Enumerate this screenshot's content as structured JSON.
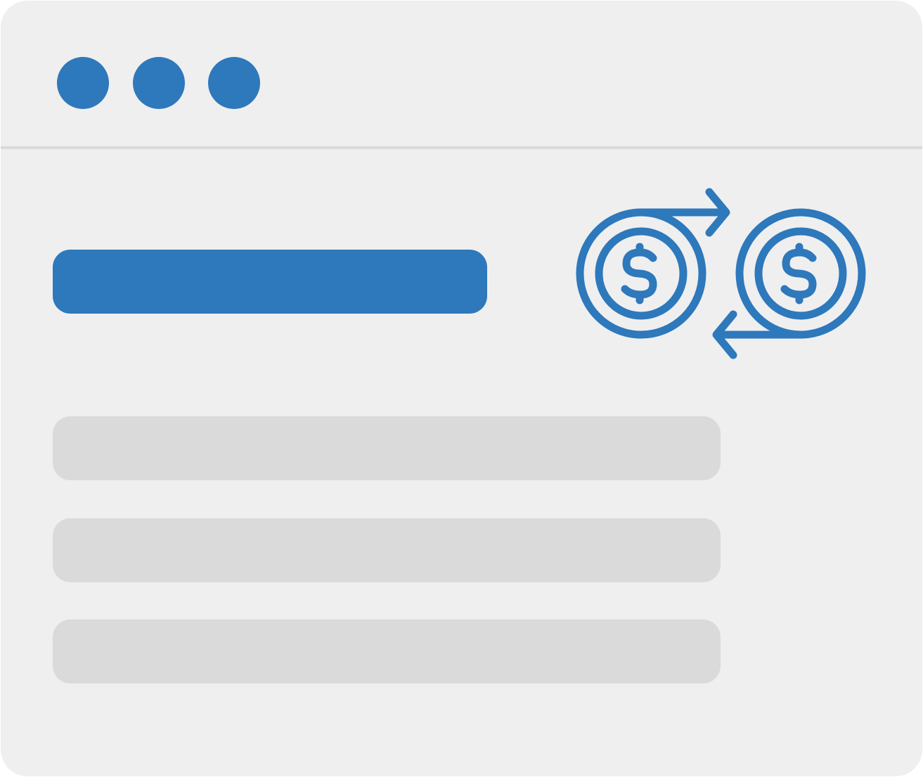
{
  "colors": {
    "accent": "#2e78bc",
    "window_background": "#efefef",
    "divider": "#dadada",
    "placeholder_bar": "#dadada"
  },
  "window": {
    "controls": [
      "window-control-dot",
      "window-control-dot",
      "window-control-dot"
    ]
  },
  "main": {
    "hero_icon": "currency-exchange-icon",
    "content_rows": [
      "placeholder-row",
      "placeholder-row",
      "placeholder-row"
    ]
  }
}
